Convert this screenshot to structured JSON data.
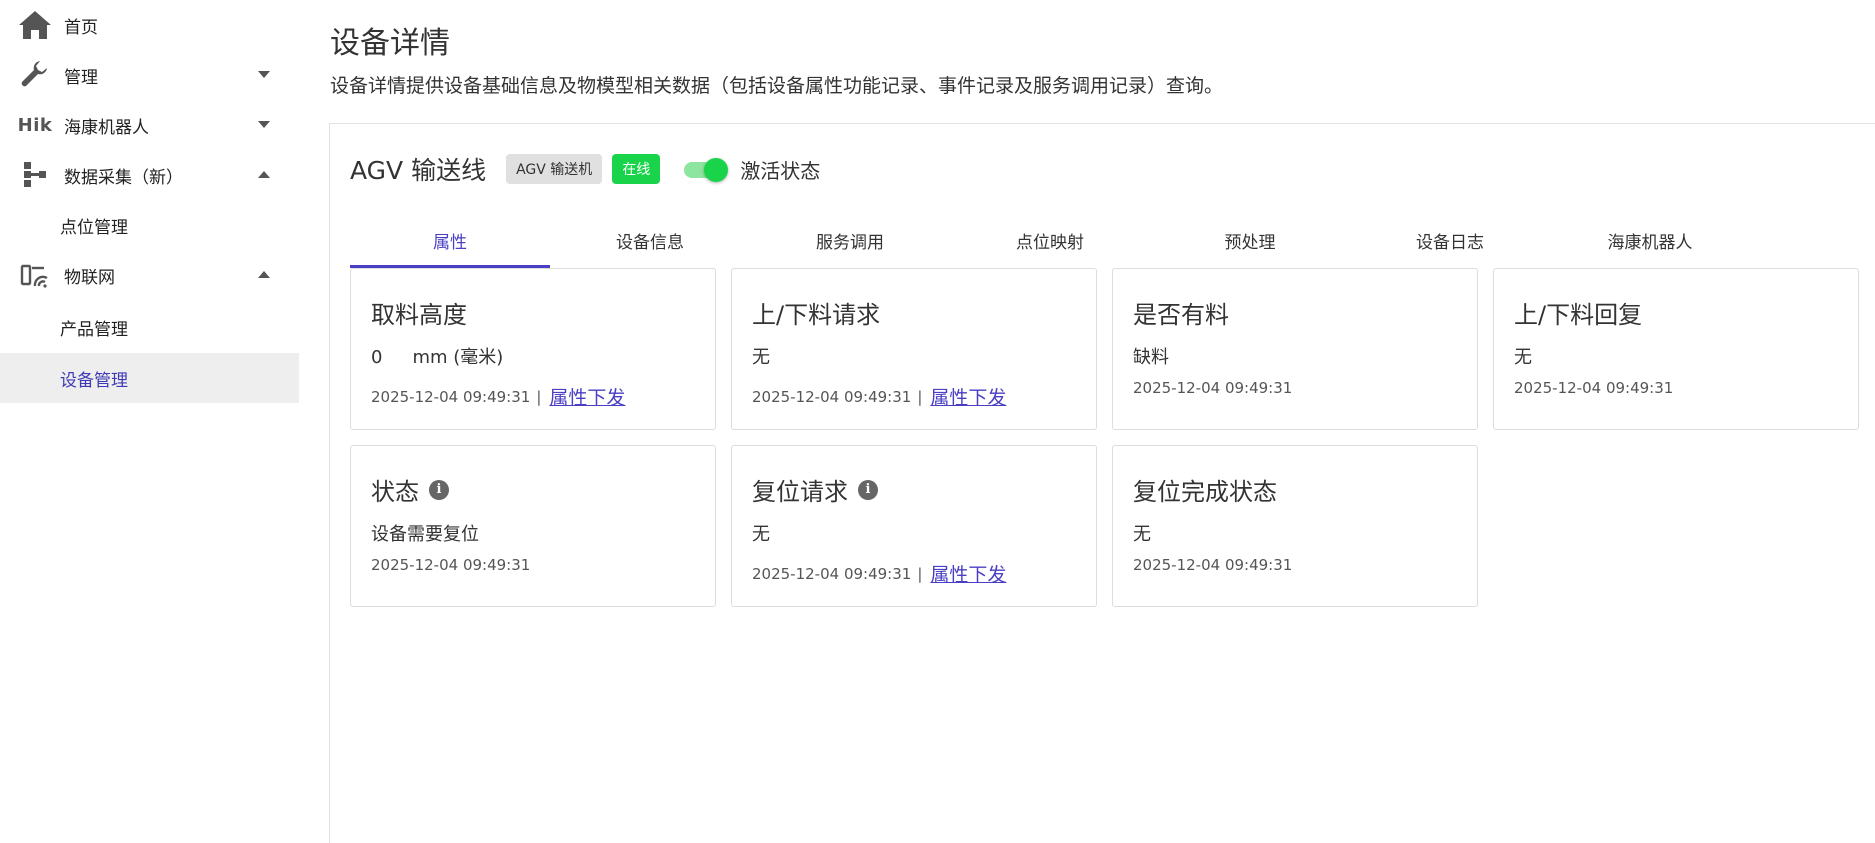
{
  "sidebar": {
    "home": "首页",
    "manage": "管理",
    "hik_logo": "Hik",
    "hik_robot": "海康机器人",
    "data_collect": "数据采集（新）",
    "point_manage": "点位管理",
    "iot": "物联网",
    "product_manage": "产品管理",
    "device_manage": "设备管理"
  },
  "page": {
    "title": "设备详情",
    "description": "设备详情提供设备基础信息及物模型相关数据（包括设备属性功能记录、事件记录及服务调用记录）查询。"
  },
  "device": {
    "name": "AGV 输送线",
    "type_chip": "AGV 输送机",
    "status_chip": "在线",
    "activation_label": "激活状态",
    "activation_on": true
  },
  "tabs": [
    "属性",
    "设备信息",
    "服务调用",
    "点位映射",
    "预处理",
    "设备日志",
    "海康机器人"
  ],
  "cards": {
    "c1": {
      "title": "取料高度",
      "value": "0",
      "unit": "mm (毫米)",
      "time": "2025-12-04 09:49:31",
      "sep": "|",
      "action": "属性下发"
    },
    "c2": {
      "title": "上/下料请求",
      "value": "无",
      "time": "2025-12-04 09:49:31",
      "sep": "|",
      "action": "属性下发"
    },
    "c3": {
      "title": "是否有料",
      "value": "缺料",
      "time": "2025-12-04 09:49:31"
    },
    "c4": {
      "title": "上/下料回复",
      "value": "无",
      "time": "2025-12-04 09:49:31"
    },
    "c5": {
      "title": "状态",
      "info": "i",
      "value": "设备需要复位",
      "time": "2025-12-04 09:49:31"
    },
    "c6": {
      "title": "复位请求",
      "info": "i",
      "value": "无",
      "time": "2025-12-04 09:49:31",
      "sep": "|",
      "action": "属性下发"
    },
    "c7": {
      "title": "复位完成状态",
      "value": "无",
      "time": "2025-12-04 09:49:31"
    }
  },
  "colors": {
    "accent": "#4a3fc4",
    "online": "#19d44a",
    "active_bg": "#eeeeee"
  },
  "icons": [
    "home-icon",
    "wrench-icon",
    "tree-icon",
    "iot-icon",
    "info-icon",
    "chevron-down-icon",
    "chevron-up-icon"
  ]
}
